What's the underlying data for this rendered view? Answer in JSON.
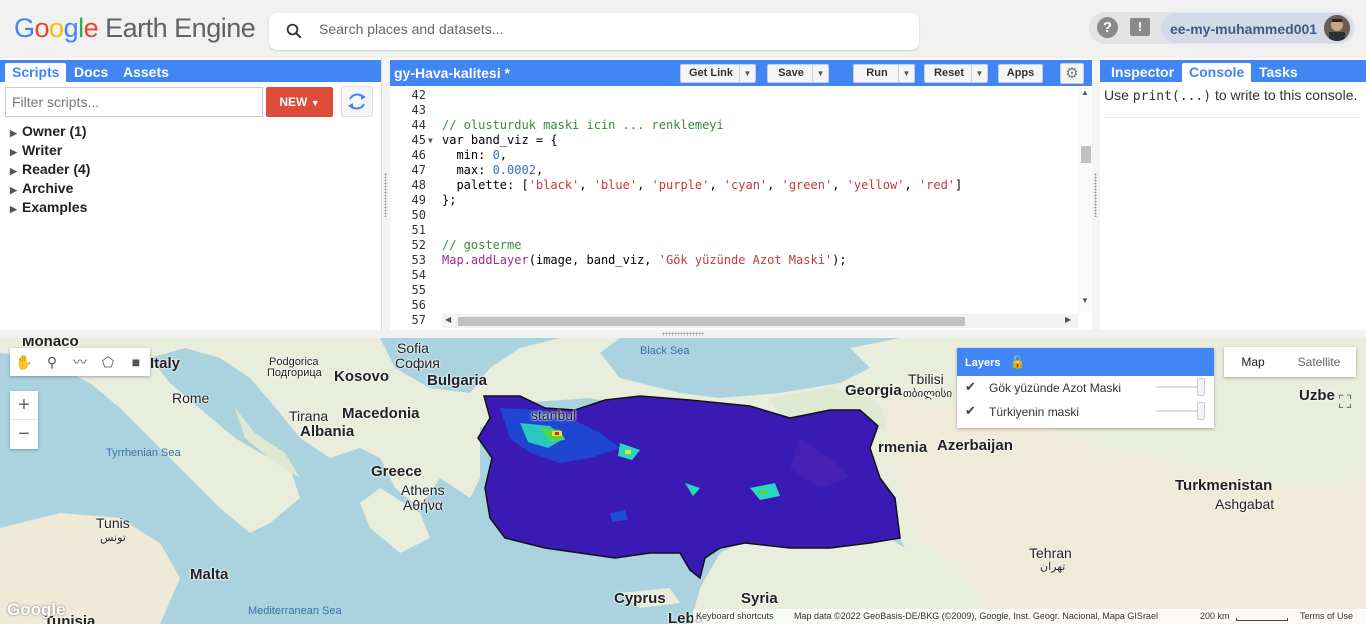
{
  "app": {
    "logo_brand": "Google",
    "logo_product": "Earth Engine",
    "search_placeholder": "Search places and datasets...",
    "username": "ee-my-muhammed001"
  },
  "left_panel": {
    "tabs": [
      "Scripts",
      "Docs",
      "Assets"
    ],
    "active_tab": "Scripts",
    "filter_placeholder": "Filter scripts...",
    "new_button": "NEW",
    "tree": [
      "Owner (1)",
      "Writer",
      "Reader (4)",
      "Archive",
      "Examples"
    ]
  },
  "editor": {
    "title": "gy-Hava-kalitesi *",
    "buttons": {
      "get_link": "Get Link",
      "save": "Save",
      "run": "Run",
      "reset": "Reset",
      "apps": "Apps"
    },
    "line_numbers": [
      "42",
      "43",
      "44",
      "45",
      "46",
      "47",
      "48",
      "49",
      "50",
      "51",
      "52",
      "53",
      "54",
      "55",
      "56",
      "57"
    ],
    "code": {
      "l44": "// olusturduk maski icin ... renklemeyi",
      "l45": "var band_viz = {",
      "l46_key": "  min: ",
      "l46_val": "0",
      "l47_key": "  max: ",
      "l47_val": "0.0002",
      "l48_key": "  palette: [",
      "palette": [
        "'black'",
        "'blue'",
        "'purple'",
        "'cyan'",
        "'green'",
        "'yellow'",
        "'red'"
      ],
      "l49": "};",
      "l52": "// gosterme",
      "l53_fn": "Map.addLayer",
      "l53_mid": "(image, band_viz, ",
      "l53_str": "'Gök yüzünde Azot Maski'",
      "l53_end": ");"
    }
  },
  "right_panel": {
    "tabs": [
      "Inspector",
      "Console",
      "Tasks"
    ],
    "active_tab": "Console",
    "console_pre": "Use ",
    "console_code": "print(...)",
    "console_post": " to write to this console."
  },
  "map": {
    "labels": {
      "monaco": "Monaco",
      "italy": "Italy",
      "rome": "Rome",
      "tyrrhenian": "Tyrrhenian Sea",
      "tunis": "Tunis",
      "tunis_ar": "تونس",
      "malta": "Malta",
      "tunisia": "Tunisia",
      "med_sea": "Mediterranean Sea",
      "podgorica": "Podgorica",
      "podgorica_cyr": "Подгорица",
      "kosovo": "Kosovo",
      "tirana": "Tirana",
      "macedonia": "Macedonia",
      "albania": "Albania",
      "greece": "Greece",
      "athens": "Athens",
      "athens_gr": "Αθήνα",
      "sofia": "Sofia",
      "sofia_cyr": "София",
      "bulgaria": "Bulgaria",
      "black_sea": "Black Sea",
      "istanbul": "stanbul",
      "georgia": "Georgia",
      "tbilisi": "Tbilisi",
      "tbilisi_ka": "თბილისი",
      "armenia": "rmenia",
      "azerbaijan": "Azerbaijan",
      "turkmenistan": "Turkmenistan",
      "ashgabat": "Ashgabat",
      "uzbek": "Uzbe",
      "tehran": "Tehran",
      "tehran_fa": "تهران",
      "cyprus": "Cyprus",
      "syria": "Syria",
      "lebanon": "Leba"
    },
    "layers_title": "Layers",
    "layers": [
      "Gök yüzünde Azot Maski",
      "Türkiyenin maski"
    ],
    "map_type": [
      "Map",
      "Satellite"
    ],
    "attribution": {
      "shortcuts": "Keyboard shortcuts",
      "data": "Map data ©2022 GeoBasis-DE/BKG (©2009), Google, Inst. Geogr. Nacional, Mapa GISrael",
      "scale": "200 km",
      "terms": "Terms of Use"
    },
    "google_watermark": "Google",
    "colors": {
      "land": "#e8eddc",
      "sea": "#aad3df",
      "mask": "#3a1ab5",
      "accent": "#4285f4"
    }
  }
}
